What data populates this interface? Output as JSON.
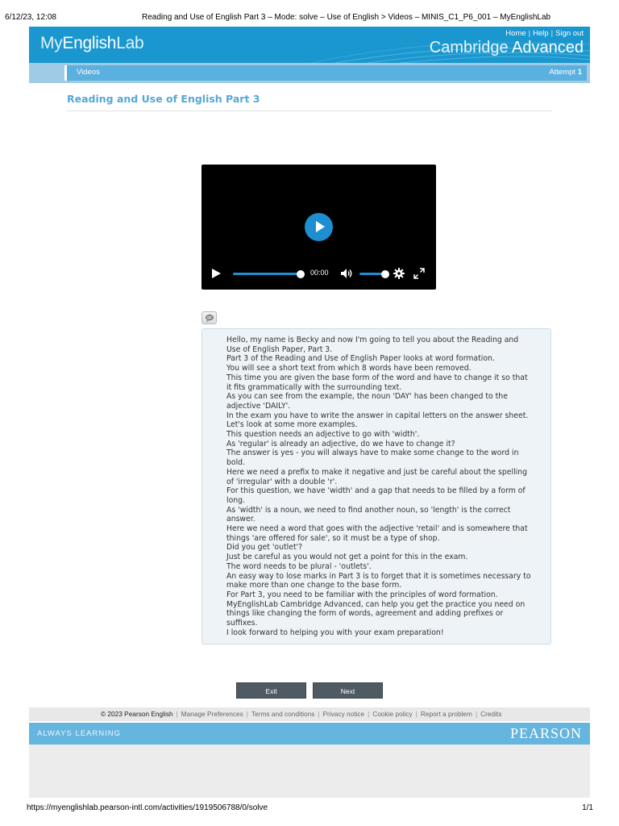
{
  "print_header": {
    "timestamp": "6/12/23, 12:08",
    "title": "Reading and Use of English Part 3 – Mode: solve – Use of English > Videos – MINIS_C1_P6_001 – MyEnglishLab"
  },
  "banner": {
    "logo_prefix": "My",
    "logo_main": "English",
    "logo_suffix": "Lab",
    "links": [
      "Home",
      "Help",
      "Sign out"
    ],
    "product_prefix": "Cambridge",
    "product_main": "Advanced"
  },
  "navbar": {
    "breadcrumb": "Videos",
    "attempt_label": "Attempt",
    "attempt_number": "1"
  },
  "page_title": "Reading and Use of English Part 3",
  "video": {
    "time": "00:00",
    "progress_fraction": 0.0,
    "volume_fraction": 1.0
  },
  "transcript": {
    "lines": [
      "Hello, my name is Becky and now I'm going to tell you about the Reading and Use of English Paper, Part 3.",
      "Part 3 of the Reading and Use of English Paper looks at word formation.",
      "You will see a short text from which 8 words have been removed.",
      "This time you are given the base form of the word and have to change it so that it fits grammatically with the surrounding text.",
      "As you can see from the example, the noun 'DAY' has been changed to the adjective 'DAILY'.",
      "In the exam you have to write the answer in capital letters on the answer sheet.",
      "Let's look at some more examples.",
      "This question needs an adjective to go with 'width'.",
      "As 'regular' is already an adjective, do we have to change it?",
      "The answer is yes - you will always have to make some change to the word in bold.",
      "Here we need a prefix to make it negative and just be careful about the spelling of 'irregular' with a double 'r'.",
      "For this question, we have 'width' and a gap that needs to be filled by a form of long.",
      "As 'width' is a noun, we need to find another noun, so 'length' is the correct answer.",
      "Here we need a word that goes with the adjective 'retail' and is somewhere that things 'are offered for sale', so it must be a type of shop.",
      "Did you get 'outlet'?",
      "Just be careful as you would not get a point for this in the exam.",
      "The word needs to be plural - 'outlets'.",
      "An easy way to lose marks in Part 3 is to forget that it is sometimes necessary to make more than one change to the base form.",
      "For Part 3, you need to be familiar with the principles of word formation.",
      "MyEnglishLab Cambridge Advanced, can help you get the practice you need on things like changing the form of words, agreement and adding prefixes or suffixes.",
      "I look forward to helping you with your exam preparation!"
    ]
  },
  "buttons": {
    "exit": "Exit",
    "next": "Next"
  },
  "legal": {
    "copyright": "© 2023 Pearson English",
    "links": [
      "Manage Preferences",
      "Terms and conditions",
      "Privacy notice",
      "Cookie policy",
      "Report a problem",
      "Credits"
    ]
  },
  "pearson_bar": {
    "tagline": "ALWAYS LEARNING",
    "brand": "PEARSON"
  },
  "print_footer": {
    "url": "https://myenglishlab.pearson-intl.com/activities/1919506788/0/solve",
    "page": "1/1"
  },
  "colors": {
    "banner": "#1a97cf",
    "accent": "#57a7d6",
    "video_accent": "#1d8fd1",
    "button": "#505a62"
  }
}
